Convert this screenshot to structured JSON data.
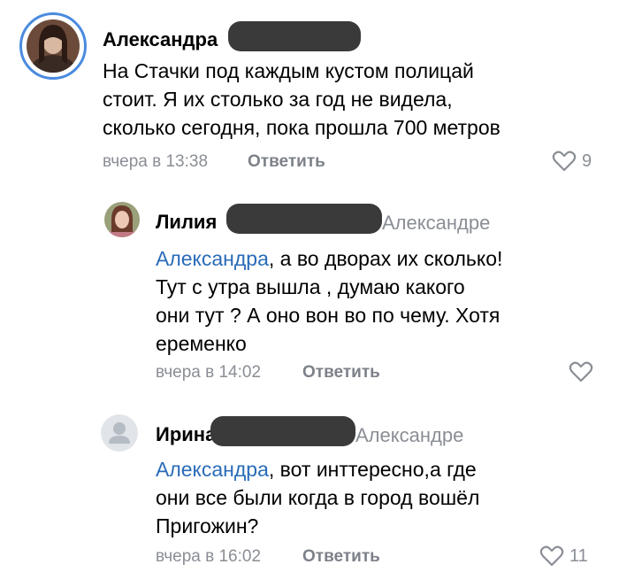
{
  "comments": [
    {
      "author": "Александра",
      "text_lines": [
        "На Стачки под каждым кустом полицай",
        "стоит. Я их столько за год не видела,",
        "сколько сегодня, пока прошла 700 метров"
      ],
      "time": "вчера в 13:38",
      "reply_label": "Ответить",
      "likes": "9",
      "like_icon": "heart-outline-icon"
    },
    {
      "author": "Лилия",
      "reply_to": "Александре",
      "mention": "Александра",
      "text_lines": [
        ", а во дворах их сколько!",
        "Тут с утра вышла , думаю какого",
        "они тут ? А оно вон во по чему. Хотя",
        "еременко"
      ],
      "time": "вчера в 14:02",
      "reply_label": "Ответить",
      "like_icon": "heart-outline-icon"
    },
    {
      "author": "Ирина",
      "reply_to": "Александре",
      "mention": "Александра",
      "text_lines": [
        ", вот инттересно,а где",
        "они все были когда в город вошёл",
        "Пригожин?"
      ],
      "time": "вчера в 16:02",
      "reply_label": "Ответить",
      "likes": "11",
      "like_icon": "heart-outline-icon"
    }
  ],
  "colors": {
    "mention": "#2a6cb8",
    "meta": "#8a8e95",
    "redaction": "#3a3a3a",
    "avatar_ring": "#4a8be0"
  }
}
